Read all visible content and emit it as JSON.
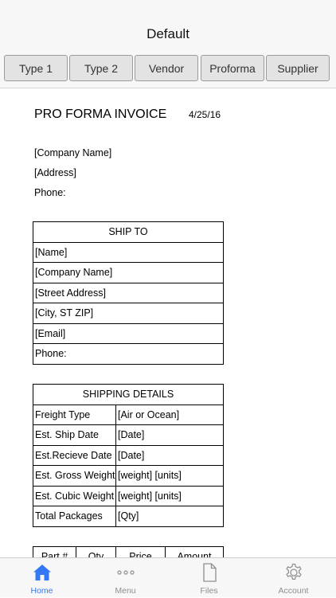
{
  "nav": {
    "title": "Default"
  },
  "segments": [
    "Type 1",
    "Type 2",
    "Vendor",
    "Proforma",
    "Supplier"
  ],
  "invoice": {
    "title": "PRO FORMA INVOICE",
    "date": "4/25/16",
    "company_name": "[Company Name]",
    "address": "[Address]",
    "phone": "Phone:"
  },
  "ship_to": {
    "header": "SHIP TO",
    "rows": [
      "[Name]",
      "[Company Name]",
      "[Street Address]",
      "[City, ST  ZIP]",
      "[Email]",
      "Phone:"
    ]
  },
  "shipping_details": {
    "header": "SHIPPING DETAILS",
    "rows": [
      [
        "Freight Type",
        "[Air or Ocean]"
      ],
      [
        "Est. Ship Date",
        "[Date]"
      ],
      [
        "Est.Recieve Date",
        "[Date]"
      ],
      [
        "Est. Gross Weight",
        "[weight] [units]"
      ],
      [
        "Est. Cubic Weight",
        "[weight] [units]"
      ],
      [
        "Total Packages",
        "[Qty]"
      ]
    ]
  },
  "items_table": {
    "headers": [
      "Part #",
      "Qty",
      "Price",
      "Amount"
    ]
  },
  "tabbar": {
    "items": [
      {
        "label": "Home",
        "icon": "home-icon",
        "active": true
      },
      {
        "label": "Menu",
        "icon": "ellipsis-icon",
        "active": false
      },
      {
        "label": "Files",
        "icon": "file-icon",
        "active": false
      },
      {
        "label": "Account",
        "icon": "gear-icon",
        "active": false
      }
    ]
  },
  "colors": {
    "accent": "#3478f6",
    "inactive": "#8e8e8e"
  }
}
